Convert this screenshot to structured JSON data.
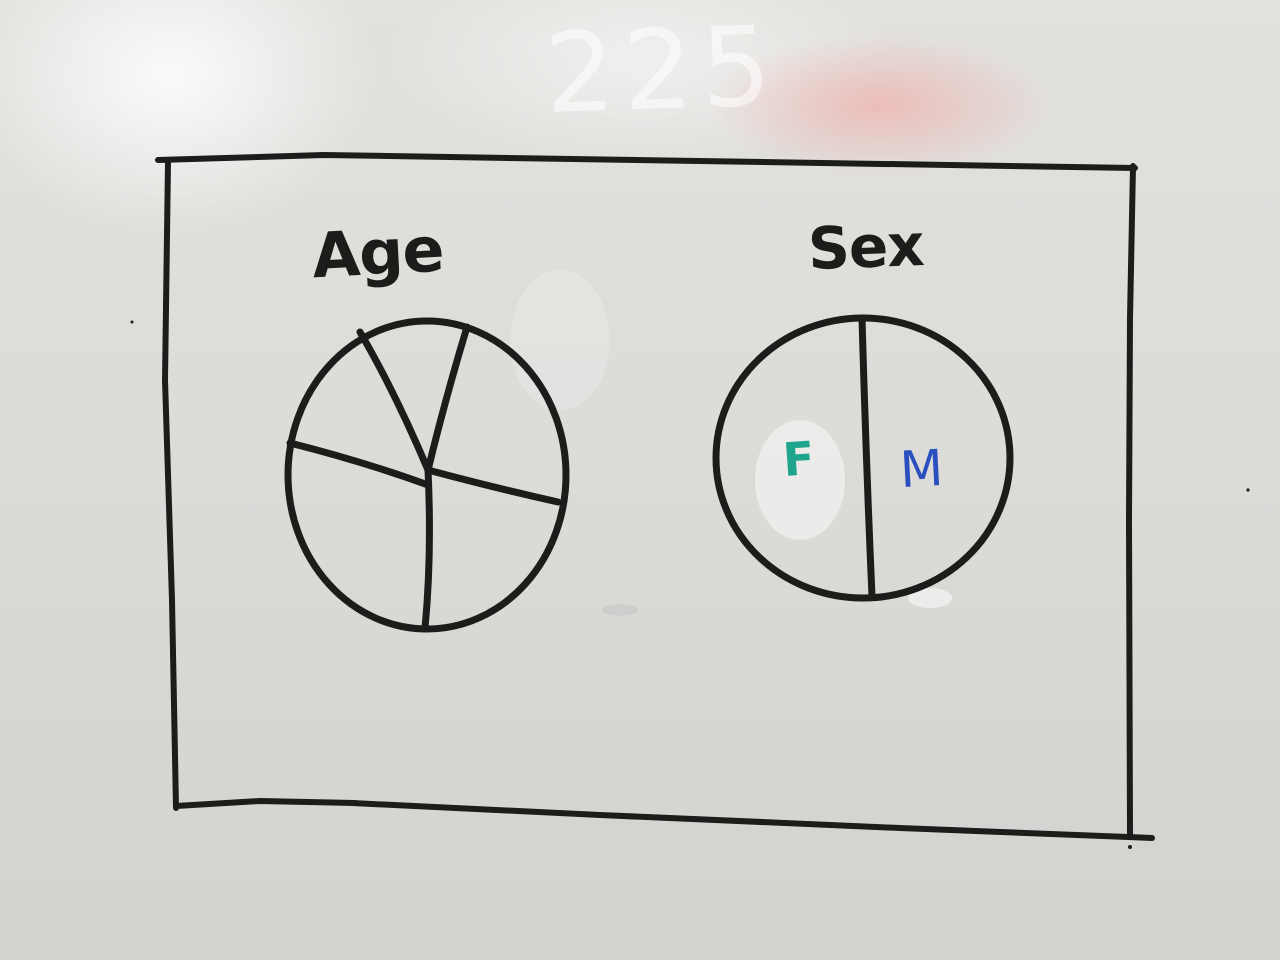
{
  "photo": {
    "board_color": "#dcdbd8",
    "marker_color": "#1c1c1a"
  },
  "ghost_text": "225",
  "age_chart": {
    "title": "Age"
  },
  "sex_chart": {
    "title": "Sex",
    "labels": [
      {
        "text": "F",
        "color": "#1fa58e"
      },
      {
        "text": "M",
        "color": "#2a4fbf"
      }
    ]
  }
}
